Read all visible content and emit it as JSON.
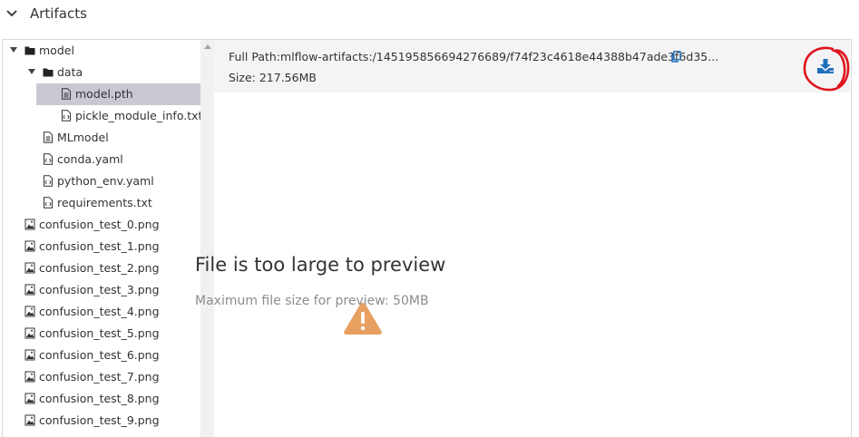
{
  "section": {
    "title": "Artifacts",
    "expanded": true
  },
  "tree": {
    "items": [
      {
        "label": "model",
        "type": "folder",
        "expanded": true,
        "level": 0
      },
      {
        "label": "data",
        "type": "folder",
        "expanded": true,
        "level": 1
      },
      {
        "label": "model.pth",
        "type": "file",
        "level": 2,
        "selected": true
      },
      {
        "label": "pickle_module_info.txt",
        "type": "code",
        "level": 2
      },
      {
        "label": "MLmodel",
        "type": "file",
        "level": 1
      },
      {
        "label": "conda.yaml",
        "type": "code",
        "level": 1
      },
      {
        "label": "python_env.yaml",
        "type": "code",
        "level": 1
      },
      {
        "label": "requirements.txt",
        "type": "code",
        "level": 1
      },
      {
        "label": "confusion_test_0.png",
        "type": "image",
        "level": 0
      },
      {
        "label": "confusion_test_1.png",
        "type": "image",
        "level": 0
      },
      {
        "label": "confusion_test_2.png",
        "type": "image",
        "level": 0
      },
      {
        "label": "confusion_test_3.png",
        "type": "image",
        "level": 0
      },
      {
        "label": "confusion_test_4.png",
        "type": "image",
        "level": 0
      },
      {
        "label": "confusion_test_5.png",
        "type": "image",
        "level": 0
      },
      {
        "label": "confusion_test_6.png",
        "type": "image",
        "level": 0
      },
      {
        "label": "confusion_test_7.png",
        "type": "image",
        "level": 0
      },
      {
        "label": "confusion_test_8.png",
        "type": "image",
        "level": 0
      },
      {
        "label": "confusion_test_9.png",
        "type": "image",
        "level": 0
      }
    ]
  },
  "detail": {
    "full_path": "Full Path:mlflow-artifacts:/145195856694276689/f74f23c4618e44388b47ade3f6d35...",
    "size": "Size: 217.56MB",
    "download_icon": "download-icon",
    "copy_icon": "copy-icon",
    "message_title": "File is too large to preview",
    "message_subtitle": "Maximum file size for preview: 50MB"
  },
  "colors": {
    "accent": "#1f6fbf",
    "warning": "#e8a060",
    "annotation": "#e0141e",
    "selected_row": "#c9c9d4"
  }
}
